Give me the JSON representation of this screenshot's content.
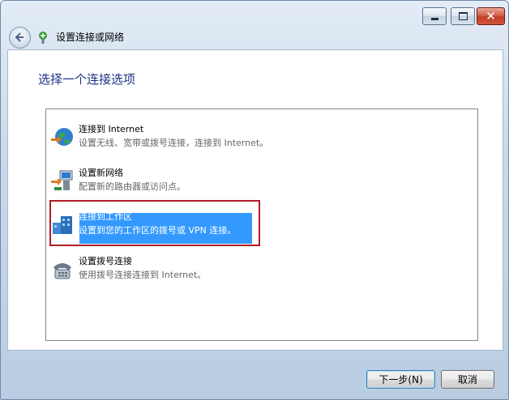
{
  "window": {
    "title": "设置连接或网络"
  },
  "main": {
    "heading": "选择一个连接选项"
  },
  "options": [
    {
      "title": "连接到 Internet",
      "desc": "设置无线、宽带或拨号连接，连接到 Internet。",
      "icon": "globe-network-icon"
    },
    {
      "title": "设置新网络",
      "desc": "配置新的路由器或访问点。",
      "icon": "new-network-icon"
    },
    {
      "title": "连接到工作区",
      "desc": "设置到您的工作区的拨号或 VPN 连接。",
      "icon": "workplace-building-icon",
      "selected": true
    },
    {
      "title": "设置拨号连接",
      "desc": "使用拨号连接连接到 Internet。",
      "icon": "dialup-phone-icon"
    }
  ],
  "buttons": {
    "next": "下一步(N)",
    "cancel": "取消"
  },
  "colors": {
    "heading": "#1e3287",
    "selection": "#3399ff",
    "highlight_frame": "#b21c24"
  }
}
